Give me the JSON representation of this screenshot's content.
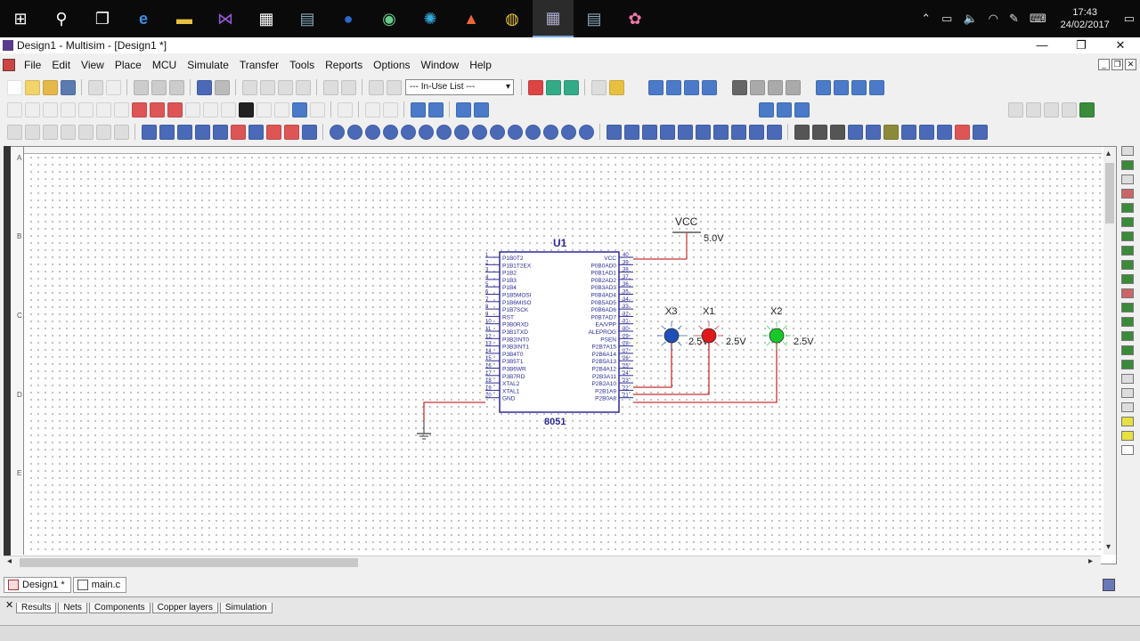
{
  "taskbar": {
    "clock_time": "17:43",
    "clock_date": "24/02/2017",
    "apps": [
      "windows-start",
      "search",
      "task-view",
      "edge",
      "file-explorer",
      "visual-studio",
      "store",
      "doc-app",
      "r-app",
      "android-studio",
      "app-blue",
      "matlab",
      "chrome",
      "multisim",
      "doc-app-2",
      "paint-app"
    ]
  },
  "window": {
    "title": "Design1 - Multisim - [Design1 *]",
    "minimize": "—",
    "restore": "❐",
    "close": "✕"
  },
  "menu": [
    "File",
    "Edit",
    "View",
    "Place",
    "MCU",
    "Simulate",
    "Transfer",
    "Tools",
    "Reports",
    "Options",
    "Window",
    "Help"
  ],
  "toolbar": {
    "in_use_list": "--- In-Use List ---"
  },
  "ruler": [
    "A",
    "B",
    "C",
    "D",
    "E"
  ],
  "schematic": {
    "chip_ref": "U1",
    "chip_part": "8051",
    "vcc_label": "VCC",
    "vcc_value": "5.0V",
    "left_pins": [
      "P1B0T2",
      "P1B1T2EX",
      "P1B2",
      "P1B3",
      "P1B4",
      "P1B5MOSI",
      "P1B6MISO",
      "P1B7SCK",
      "RST",
      "P3B0RXD",
      "P3B1TXD",
      "P3B2INT0",
      "P3B3INT1",
      "P3B4T0",
      "P3B5T1",
      "P3B6WR",
      "P3B7RD",
      "XTAL2",
      "XTAL1",
      "GND"
    ],
    "left_nums": [
      "1",
      "2",
      "3",
      "4",
      "5",
      "6",
      "7",
      "8",
      "9",
      "10",
      "11",
      "12",
      "13",
      "14",
      "15",
      "16",
      "17",
      "18",
      "19",
      "20"
    ],
    "right_pins": [
      "VCC",
      "P0B0AD0",
      "P0B1AD1",
      "P0B2AD2",
      "P0B3AD3",
      "P0B4AD4",
      "P0B5AD5",
      "P0B6AD6",
      "P0B7AD7",
      "EA/VPP",
      "ALEPROG",
      "PSEN",
      "P2B7A15",
      "P2B6A14",
      "P2B5A13",
      "P2B4A12",
      "P2B3A11",
      "P2B2A10",
      "P2B1A9",
      "P2B0A8"
    ],
    "right_nums": [
      "40",
      "39",
      "38",
      "37",
      "36",
      "35",
      "34",
      "33",
      "32",
      "31",
      "30",
      "29",
      "28",
      "27",
      "26",
      "25",
      "24",
      "23",
      "22",
      "21"
    ],
    "leds": [
      {
        "ref": "X3",
        "voltage": "2.5V",
        "color": "#1e4fb8"
      },
      {
        "ref": "X1",
        "voltage": "2.5V",
        "color": "#e01818"
      },
      {
        "ref": "X2",
        "voltage": "2.5V",
        "color": "#18c828"
      }
    ],
    "wire_color": "#c83030",
    "chip_color": "#2a2a9a"
  },
  "tabs": [
    {
      "label": "Design1 *"
    },
    {
      "label": "main.c"
    }
  ],
  "bottom_tabs": [
    "Results",
    "Nets",
    "Components",
    "Copper layers",
    "Simulation"
  ]
}
